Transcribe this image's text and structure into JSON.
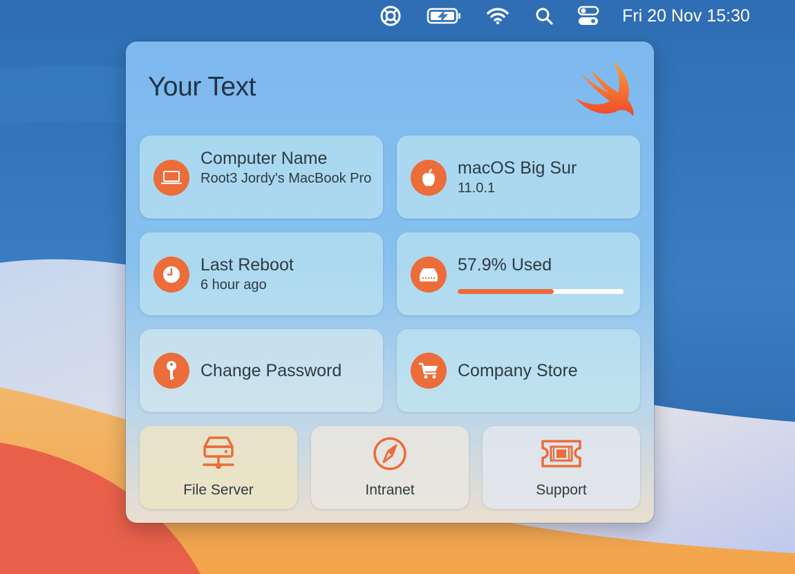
{
  "menubar": {
    "icons": [
      "lifebuoy-icon",
      "battery-charging-icon",
      "wifi-icon",
      "search-icon",
      "control-center-icon"
    ],
    "datetime": "Fri 20 Nov  15:30"
  },
  "panel": {
    "title": "Your Text",
    "logo": "swift-logo",
    "accent_color": "#ec6c3a",
    "tiles": {
      "computer": {
        "icon": "laptop-icon",
        "title": "Computer Name",
        "value": "Root3 Jordy's MacBook Pro"
      },
      "os": {
        "icon": "apple-icon",
        "title": "macOS Big Sur",
        "value": "11.0.1"
      },
      "reboot": {
        "icon": "clock-icon",
        "title": "Last Reboot",
        "value": "6 hour ago"
      },
      "storage": {
        "icon": "disk-icon",
        "title": "57.9% Used",
        "used_percent": 57.9
      },
      "password": {
        "icon": "key-icon",
        "title": "Change Password"
      },
      "store": {
        "icon": "cart-icon",
        "title": "Company Store"
      }
    },
    "shortcuts": [
      {
        "icon": "file-server-icon",
        "label": "File Server"
      },
      {
        "icon": "compass-icon",
        "label": "Intranet"
      },
      {
        "icon": "ticket-icon",
        "label": "Support"
      }
    ]
  }
}
